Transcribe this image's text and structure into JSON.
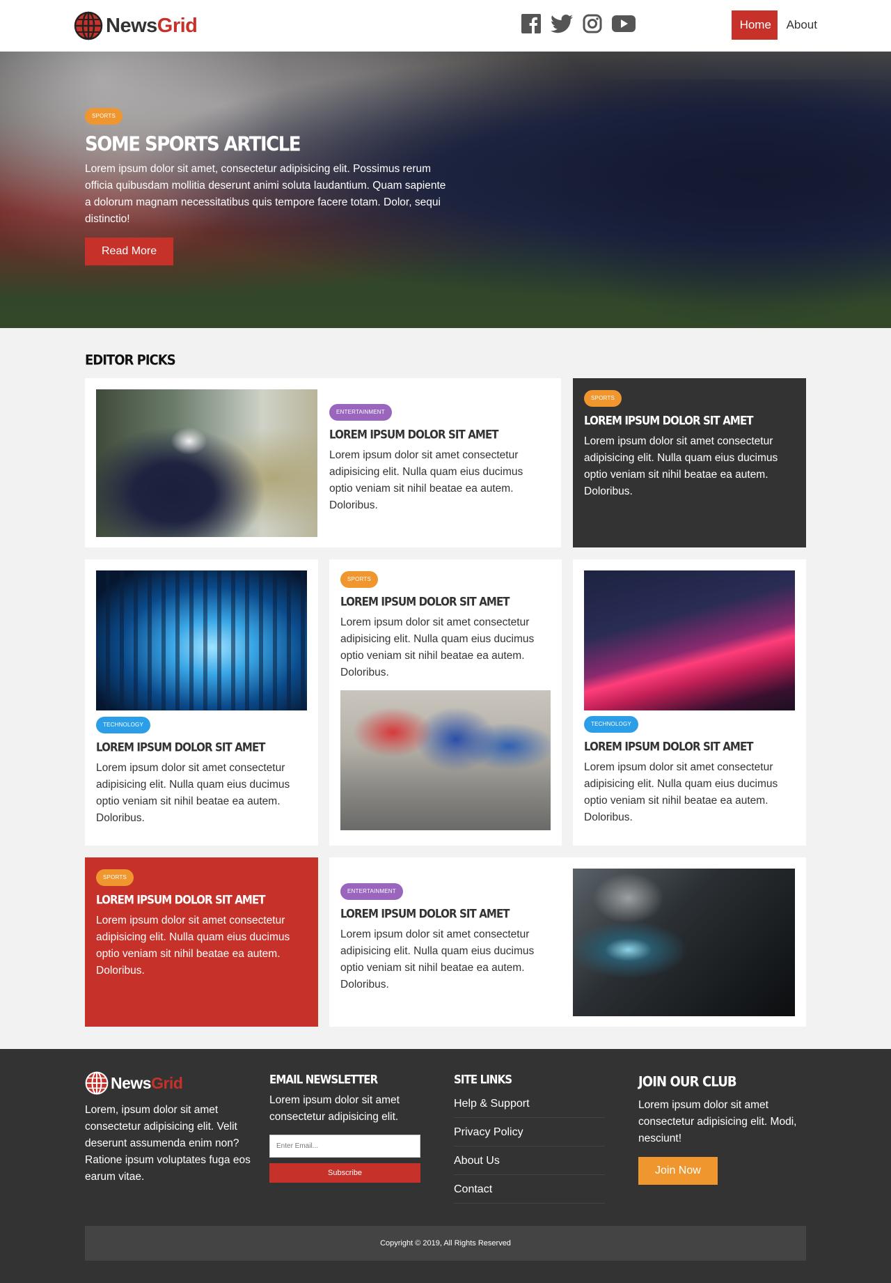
{
  "navbar": {
    "logo": {
      "word1": "News",
      "word2": "Grid"
    },
    "social": [
      "facebook-icon",
      "twitter-icon",
      "instagram-icon",
      "youtube-icon"
    ],
    "links": {
      "home": "Home",
      "about": "About"
    }
  },
  "hero": {
    "category": "Sports",
    "title": "Some Sports Article",
    "text": "Lorem ipsum dolor sit amet, consectetur adipisicing elit. Possimus rerum officia quibusdam mollitia deserunt animi soluta laudantium. Quam sapiente a dolorum magnam necessitatibus quis tempore facere totam. Dolor, sequi distinctio!",
    "button": "Read More"
  },
  "picks": {
    "heading": "Editor Picks",
    "cards": [
      {
        "category": "Entertainment",
        "title": "Lorem ipsum dolor sit amet",
        "text": "Lorem ipsum dolor sit amet consectetur adipisicing elit. Nulla quam eius ducimus optio veniam sit nihil beatae ea autem. Doloribus."
      },
      {
        "category": "Sports",
        "title": "Lorem ipsum dolor sit amet",
        "text": "Lorem ipsum dolor sit amet consectetur adipisicing elit. Nulla quam eius ducimus optio veniam sit nihil beatae ea autem. Doloribus."
      },
      {
        "category": "Technology",
        "title": "Lorem ipsum dolor sit amet",
        "text": "Lorem ipsum dolor sit amet consectetur adipisicing elit. Nulla quam eius ducimus optio veniam sit nihil beatae ea autem. Doloribus."
      },
      {
        "category": "Sports",
        "title": "Lorem ipsum dolor sit amet",
        "text": "Lorem ipsum dolor sit amet consectetur adipisicing elit. Nulla quam eius ducimus optio veniam sit nihil beatae ea autem. Doloribus."
      },
      {
        "category": "Technology",
        "title": "Lorem ipsum dolor sit amet",
        "text": "Lorem ipsum dolor sit amet consectetur adipisicing elit. Nulla quam eius ducimus optio veniam sit nihil beatae ea autem. Doloribus."
      },
      {
        "category": "Sports",
        "title": "Lorem ipsum dolor sit amet",
        "text": "Lorem ipsum dolor sit amet consectetur adipisicing elit. Nulla quam eius ducimus optio veniam sit nihil beatae ea autem. Doloribus."
      },
      {
        "category": "Entertainment",
        "title": "Lorem ipsum dolor sit amet",
        "text": "Lorem ipsum dolor sit amet consectetur adipisicing elit. Nulla quam eius ducimus optio veniam sit nihil beatae ea autem. Doloribus."
      }
    ]
  },
  "footer": {
    "logo": {
      "word1": "News",
      "word2": "Grid"
    },
    "about": "Lorem, ipsum dolor sit amet consectetur adipisicing elit. Velit deserunt assumenda enim non? Ratione ipsum voluptates fuga eos earum vitae.",
    "newsletter": {
      "heading": "Email Newsletter",
      "text": "Lorem ipsum dolor sit amet consectetur adipisicing elit.",
      "placeholder": "Enter Email...",
      "button": "Subscribe"
    },
    "site_links": {
      "heading": "Site Links",
      "items": [
        "Help & Support",
        "Privacy Policy",
        "About Us",
        "Contact"
      ]
    },
    "club": {
      "heading": "Join Our Club",
      "text": "Lorem ipsum dolor sit amet consectetur adipisicing elit. Modi, nesciunt!",
      "button": "Join Now"
    },
    "copyright": "Copyright © 2019, All Rights Reserved"
  },
  "colors": {
    "primary_red": "#c6312a",
    "dark": "#333333",
    "sports": "#f0962f",
    "entertainment": "#9a65bd",
    "technology": "#2c9ee8"
  }
}
